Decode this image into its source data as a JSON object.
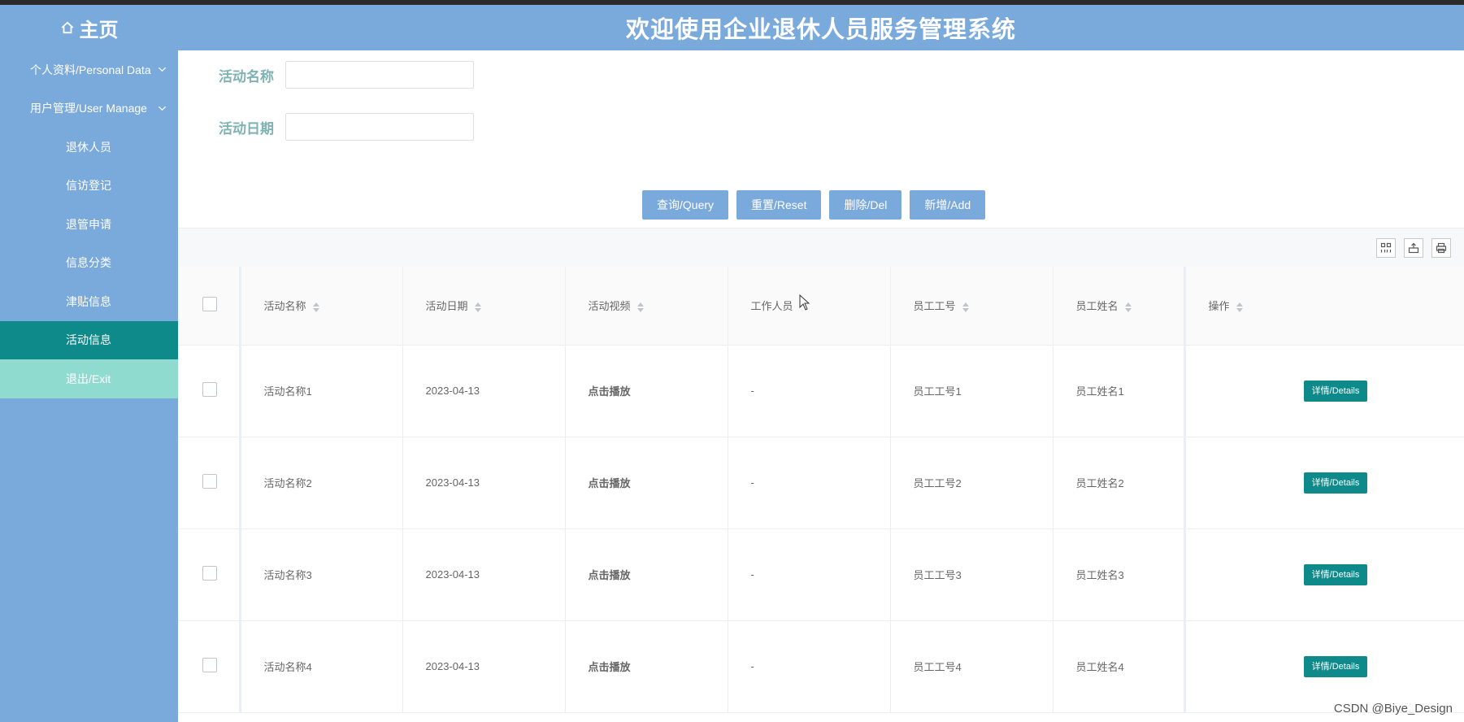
{
  "header": {
    "home_label": "主页",
    "title": "欢迎使用企业退休人员服务管理系统"
  },
  "sidebar": {
    "items": [
      {
        "label": "个人资料/Personal Data",
        "type": "group"
      },
      {
        "label": "用户管理/User Manage",
        "type": "group"
      },
      {
        "label": "退休人员",
        "type": "sub"
      },
      {
        "label": "信访登记",
        "type": "sub"
      },
      {
        "label": "退管申请",
        "type": "sub"
      },
      {
        "label": "信息分类",
        "type": "sub"
      },
      {
        "label": "津贴信息",
        "type": "sub"
      },
      {
        "label": "活动信息",
        "type": "sub",
        "active": true
      },
      {
        "label": "退出/Exit",
        "type": "sub"
      }
    ]
  },
  "search": {
    "name_label": "活动名称",
    "name_value": "",
    "date_label": "活动日期",
    "date_value": ""
  },
  "buttons": {
    "query": "查询/Query",
    "reset": "重置/Reset",
    "delete": "删除/Del",
    "add": "新增/Add"
  },
  "table": {
    "columns": [
      "活动名称",
      "活动日期",
      "活动视频",
      "工作人员",
      "员工工号",
      "员工姓名",
      "操作"
    ],
    "rows": [
      {
        "name": "活动名称1",
        "date": "2023-04-13",
        "video": "点击播放",
        "staff": "-",
        "emp_id": "员工工号1",
        "emp_name": "员工姓名1",
        "action": "详情/Details"
      },
      {
        "name": "活动名称2",
        "date": "2023-04-13",
        "video": "点击播放",
        "staff": "-",
        "emp_id": "员工工号2",
        "emp_name": "员工姓名2",
        "action": "详情/Details"
      },
      {
        "name": "活动名称3",
        "date": "2023-04-13",
        "video": "点击播放",
        "staff": "-",
        "emp_id": "员工工号3",
        "emp_name": "员工姓名3",
        "action": "详情/Details"
      },
      {
        "name": "活动名称4",
        "date": "2023-04-13",
        "video": "点击播放",
        "staff": "-",
        "emp_id": "员工工号4",
        "emp_name": "员工姓名4",
        "action": "详情/Details"
      }
    ]
  },
  "watermark": "CSDN @Biye_Design",
  "colors": {
    "header_bg": "#7aaadb",
    "active_item": "#0f8a8a",
    "exit_item": "#8fdbd0",
    "label_text": "#7fb2b2"
  }
}
